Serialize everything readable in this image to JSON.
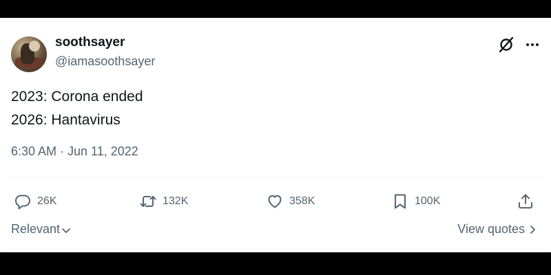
{
  "author": {
    "name": "soothsayer",
    "handle": "@iamasoothsayer"
  },
  "tweet": {
    "lines": [
      "2023: Corona ended",
      "2026: Hantavirus"
    ],
    "timestamp": "6:30 AM · Jun 11, 2022"
  },
  "actions": {
    "replies": "26K",
    "reposts": "132K",
    "likes": "358K",
    "bookmarks": "100K"
  },
  "footer": {
    "sort_label": "Relevant",
    "view_quotes_label": "View quotes"
  },
  "colors": {
    "text": "#0f1419",
    "secondary": "#536471",
    "divider": "#eff3f4",
    "frame": "#000000"
  },
  "icons": [
    "avatar",
    "grok-icon",
    "more-icon",
    "reply-icon",
    "repost-icon",
    "like-icon",
    "bookmark-icon",
    "share-icon",
    "chevron-down-icon",
    "chevron-right-icon"
  ]
}
